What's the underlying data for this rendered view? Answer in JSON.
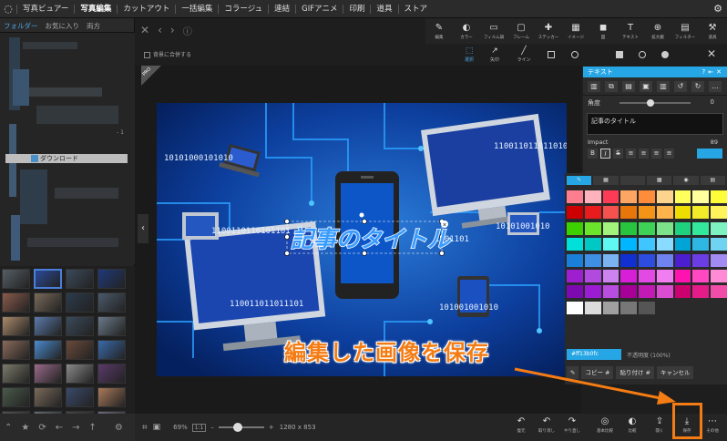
{
  "menu": {
    "items": [
      "写真ビュアー",
      "写真編集",
      "カットアウト",
      "一括編集",
      "コラージュ",
      "連結",
      "GIFアニメ",
      "印刷",
      "道具",
      "ストア"
    ],
    "active_index": 1
  },
  "left": {
    "tabs": [
      "フォルダー",
      "お気に入り",
      "両方"
    ],
    "folder_label": "ダウンロード",
    "count_marker": "- 1"
  },
  "center": {
    "merge_bg_label": "背景に合併する",
    "pro_label": "PRO"
  },
  "toolbar": {
    "items": [
      {
        "label": "編集",
        "icon": "edit-icon",
        "glyph": "✎"
      },
      {
        "label": "カラー",
        "icon": "color-icon",
        "glyph": "◐"
      },
      {
        "label": "フィルム調",
        "icon": "film-icon",
        "glyph": "▭"
      },
      {
        "label": "フレーム",
        "icon": "frame-icon",
        "glyph": "▢"
      },
      {
        "label": "ステッカー",
        "icon": "sticker-icon",
        "glyph": "✚"
      },
      {
        "label": "イメージ",
        "icon": "image-icon",
        "glyph": "▦"
      },
      {
        "label": "図",
        "icon": "shape-icon",
        "glyph": "◼"
      },
      {
        "label": "テキスト",
        "icon": "text-icon",
        "glyph": "T"
      },
      {
        "label": "拡大鏡",
        "icon": "magnifier-icon",
        "glyph": "⊕"
      },
      {
        "label": "フィルター",
        "icon": "filter-icon",
        "glyph": "▤"
      },
      {
        "label": "道具",
        "icon": "tools-icon",
        "glyph": "⚒"
      }
    ]
  },
  "subtools": [
    {
      "label": "選択",
      "icon": "select-icon",
      "glyph": "⬚"
    },
    {
      "label": "矢印",
      "icon": "arrow-icon",
      "glyph": "↗"
    },
    {
      "label": "ライン",
      "icon": "line-icon",
      "glyph": "╱"
    }
  ],
  "text_panel": {
    "title": "テキスト",
    "angle_label": "角度",
    "angle_value": "0",
    "text_value": "記事のタイトル",
    "font_name": "Impact",
    "font_size": "89",
    "style_buttons": [
      "B",
      "I",
      "S",
      "≡",
      "≡",
      "≡",
      "≡"
    ]
  },
  "palette": {
    "hex_value": "#ff13b0fc",
    "opacity_label": "不透明度 (100%)",
    "copy_label": "コピー #",
    "paste_label": "貼り付け #",
    "cancel_label": "キャンセル",
    "rows": [
      [
        "#fd7f8f",
        "#fdb2bc",
        "#fd3b57",
        "#fda562",
        "#fe8d3b",
        "#fcd48d",
        "#feff5c",
        "#ffff9d",
        "#fdfd3a"
      ],
      [
        "#cc0000",
        "#e81c1c",
        "#f5514f",
        "#e8760a",
        "#f39419",
        "#ffb34d",
        "#eede00",
        "#f2eb2a",
        "#fff45c"
      ],
      [
        "#3dcf00",
        "#6ae52c",
        "#a4f27e",
        "#28c43f",
        "#3ed356",
        "#7ce38b",
        "#1fd17f",
        "#33e89a",
        "#7ff2c1"
      ],
      [
        "#00e0da",
        "#00c8c4",
        "#5ff7f2",
        "#00b7ff",
        "#3fc5ff",
        "#89dcff",
        "#00a5d6",
        "#2fb7e3",
        "#71d3f2"
      ],
      [
        "#1a7fd8",
        "#3f8fe4",
        "#7bb3f2",
        "#1130cf",
        "#2d4de0",
        "#6e82f0",
        "#4b1fcf",
        "#6c3de3",
        "#a28cf2"
      ],
      [
        "#9e1fd0",
        "#b34ae0",
        "#cc83f0",
        "#d81fd8",
        "#e34ae3",
        "#f07ef0",
        "#ff13b0",
        "#ff48c2",
        "#ff8ad6"
      ],
      [
        "#7d0ab0",
        "#9b1cd3",
        "#b84de0",
        "#a60099",
        "#c21ab5",
        "#db4dd0",
        "#cc006e",
        "#e31c8a",
        "#f04da8"
      ],
      [
        "#ffffff",
        "#dcdcdc",
        "#a0a0a0",
        "#777777",
        "#555555",
        "#2a2a2a",
        "#2a2a2a",
        "#2a2a2a",
        "#2a2a2a"
      ]
    ]
  },
  "photo": {
    "title_text": "記事のタイトル",
    "binary": [
      "10101000101010",
      "1100110110101101",
      "110011011011101",
      "1100110110110100",
      "10101001010",
      "101001001010",
      "1001101"
    ]
  },
  "bottom": {
    "zoom": "69%",
    "zoom_fit": "1:1",
    "dimensions": "1280 x 853",
    "actions": [
      {
        "label": "復元",
        "icon": "undo-icon",
        "glyph": "↶"
      },
      {
        "label": "取り消し",
        "icon": "undo-step-icon",
        "glyph": "↶"
      },
      {
        "label": "やり直し",
        "icon": "redo-icon",
        "glyph": "↷"
      },
      {
        "label": "基本比較",
        "icon": "compare-icon",
        "glyph": "◎"
      },
      {
        "label": "比較",
        "icon": "compare2-icon",
        "glyph": "◐"
      },
      {
        "label": "開く",
        "icon": "open-icon",
        "glyph": "⇪"
      },
      {
        "label": "保存",
        "icon": "save-icon",
        "glyph": "⤓"
      },
      {
        "label": "その他",
        "icon": "more-icon",
        "glyph": "⋯"
      }
    ]
  },
  "annotation": {
    "caption": "編集した画像を保存",
    "color": "#f47c14"
  }
}
